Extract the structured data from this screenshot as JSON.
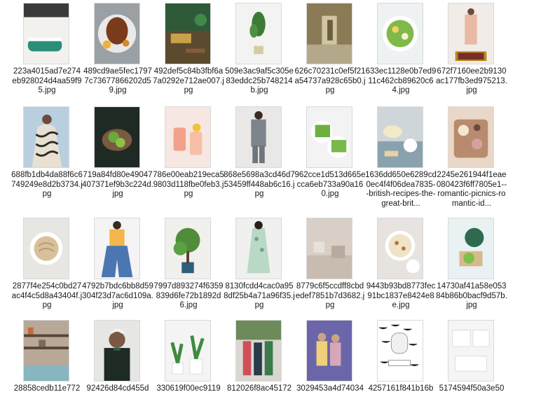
{
  "files": [
    {
      "name": "223a4015ad7e274eb928024d4aa59f95.jpg",
      "thumb": "bathtub"
    },
    {
      "name": "489cd9ae5fec17977c73677866202d59.jpg",
      "thumb": "plate-meat"
    },
    {
      "name": "492def5c84b3fbf6a7a0292e712ae007.jpg",
      "thumb": "livingroom-green"
    },
    {
      "name": "509e3ac9af5c305e83eddc25b748214b.jpg",
      "thumb": "plant-pot"
    },
    {
      "name": "626c70231c0ef5f21a54737a928c65b0.jpg",
      "thumb": "hallway"
    },
    {
      "name": "633ec1128e0b7ed911c462cb89620c64.jpg",
      "thumb": "salad-bowl"
    },
    {
      "name": "672f7160ee2b9130ac177fb3ed975213.jpg",
      "thumb": "woman-coat-rug"
    },
    {
      "name": "688fb1db4da88f6c6749249e8d2b3734.jpg",
      "thumb": "patterned-coat"
    },
    {
      "name": "719a84fd80e49047407371ef9b3c224d.jpg",
      "thumb": "dark-greens"
    },
    {
      "name": "786e00eab219eca59803d118fbe0feb3.jpg",
      "thumb": "pink-drinks"
    },
    {
      "name": "868e5698a3cd46d753459ff448ab6c16.jpg",
      "thumb": "man-suit"
    },
    {
      "name": "962cce1d513d665ecca6eb733a90a160.jpg",
      "thumb": "avocado-toast"
    },
    {
      "name": "1636dd650e6289cd0ec4f4f06dea7835--british-recipes-the-great-brit...",
      "thumb": "cake-table"
    },
    {
      "name": "2245e261944f1eae080423f6ff7805e1--romantic-picnics-romantic-id...",
      "thumb": "picnic-board"
    },
    {
      "name": "2877f4e254c0bd27ac4f4c5d8a43404f.jpg",
      "thumb": "pasta"
    },
    {
      "name": "4792b7bdc6bb8d59304f23d7ac6d109a.jpg",
      "thumb": "woman-jeans"
    },
    {
      "name": "7997d893274f6359839d6fe72b1892d6.jpg",
      "thumb": "fig-tree"
    },
    {
      "name": "8130fcdd4cac0a958df25b4a71a96f35.jpg",
      "thumb": "floral-dress"
    },
    {
      "name": "8779c6f5ccdff8cbdedef7851b7d3682.jpg",
      "thumb": "beige-room"
    },
    {
      "name": "9443b93bd8773fec91bc1837e8424e8e.jpg",
      "thumb": "soup"
    },
    {
      "name": "14730af41a58e05384b86b0bacf9d57b.jpg",
      "thumb": "greens-toast"
    },
    {
      "name": "28858cedb11e772",
      "thumb": "kitchen-shelves"
    },
    {
      "name": "92426d84cd455d",
      "thumb": "man-bow-tie"
    },
    {
      "name": "330619f00ec9119",
      "thumb": "potted-plants"
    },
    {
      "name": "812026f8ac45172",
      "thumb": "street-group"
    },
    {
      "name": "3029453a4d74034",
      "thumb": "kids-purple"
    },
    {
      "name": "4257161f841b16b",
      "thumb": "mirror-bath"
    },
    {
      "name": "5174594f50a3e50",
      "thumb": "white-kitchen"
    }
  ]
}
